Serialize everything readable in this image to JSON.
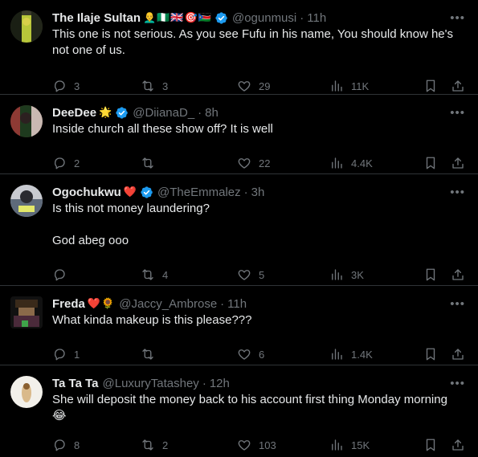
{
  "tweets": [
    {
      "name": "The Ilaje Sultan",
      "emojis": "👨‍🦲🇳🇬🇬🇧🎯🇸🇸",
      "verified": true,
      "handle": "@ogunmusi",
      "time": "11h",
      "text": "This one is not serious. As you see Fufu in his name, You should know he's not one of us.",
      "replies": "3",
      "retweets": "3",
      "likes": "29",
      "views": "11K"
    },
    {
      "name": "DeeDee",
      "emojis": "🌟",
      "verified": true,
      "handle": "@DiianaD_",
      "time": "8h",
      "text": "Inside church all these show off? It is well",
      "replies": "2",
      "retweets": "",
      "likes": "22",
      "views": "4.4K"
    },
    {
      "name": "Ogochukwu",
      "emojis": "❤️",
      "verified": true,
      "handle": "@TheEmmalez",
      "time": "3h",
      "text": "Is this not money laundering?\n\nGod abeg ooo",
      "replies": "",
      "retweets": "4",
      "likes": "5",
      "views": "3K"
    },
    {
      "name": "Freda",
      "emojis": "❤️🌻",
      "verified": false,
      "handle": "@Jaccy_Ambrose",
      "time": "11h",
      "text": "What kinda makeup is this please???",
      "replies": "1",
      "retweets": "",
      "likes": "6",
      "views": "1.4K"
    },
    {
      "name": "Ta Ta Ta",
      "emojis": "",
      "verified": false,
      "handle": "@LuxuryTatashey",
      "time": "12h",
      "text": "She will deposit the money back to his account first thing Monday morning\n😂",
      "replies": "8",
      "retweets": "2",
      "likes": "103",
      "views": "15K"
    }
  ],
  "colors": {
    "background": "#000000",
    "text": "#e7e9ea",
    "muted": "#71767b",
    "verified": "#1d9bf0",
    "divider": "#2f3336"
  }
}
